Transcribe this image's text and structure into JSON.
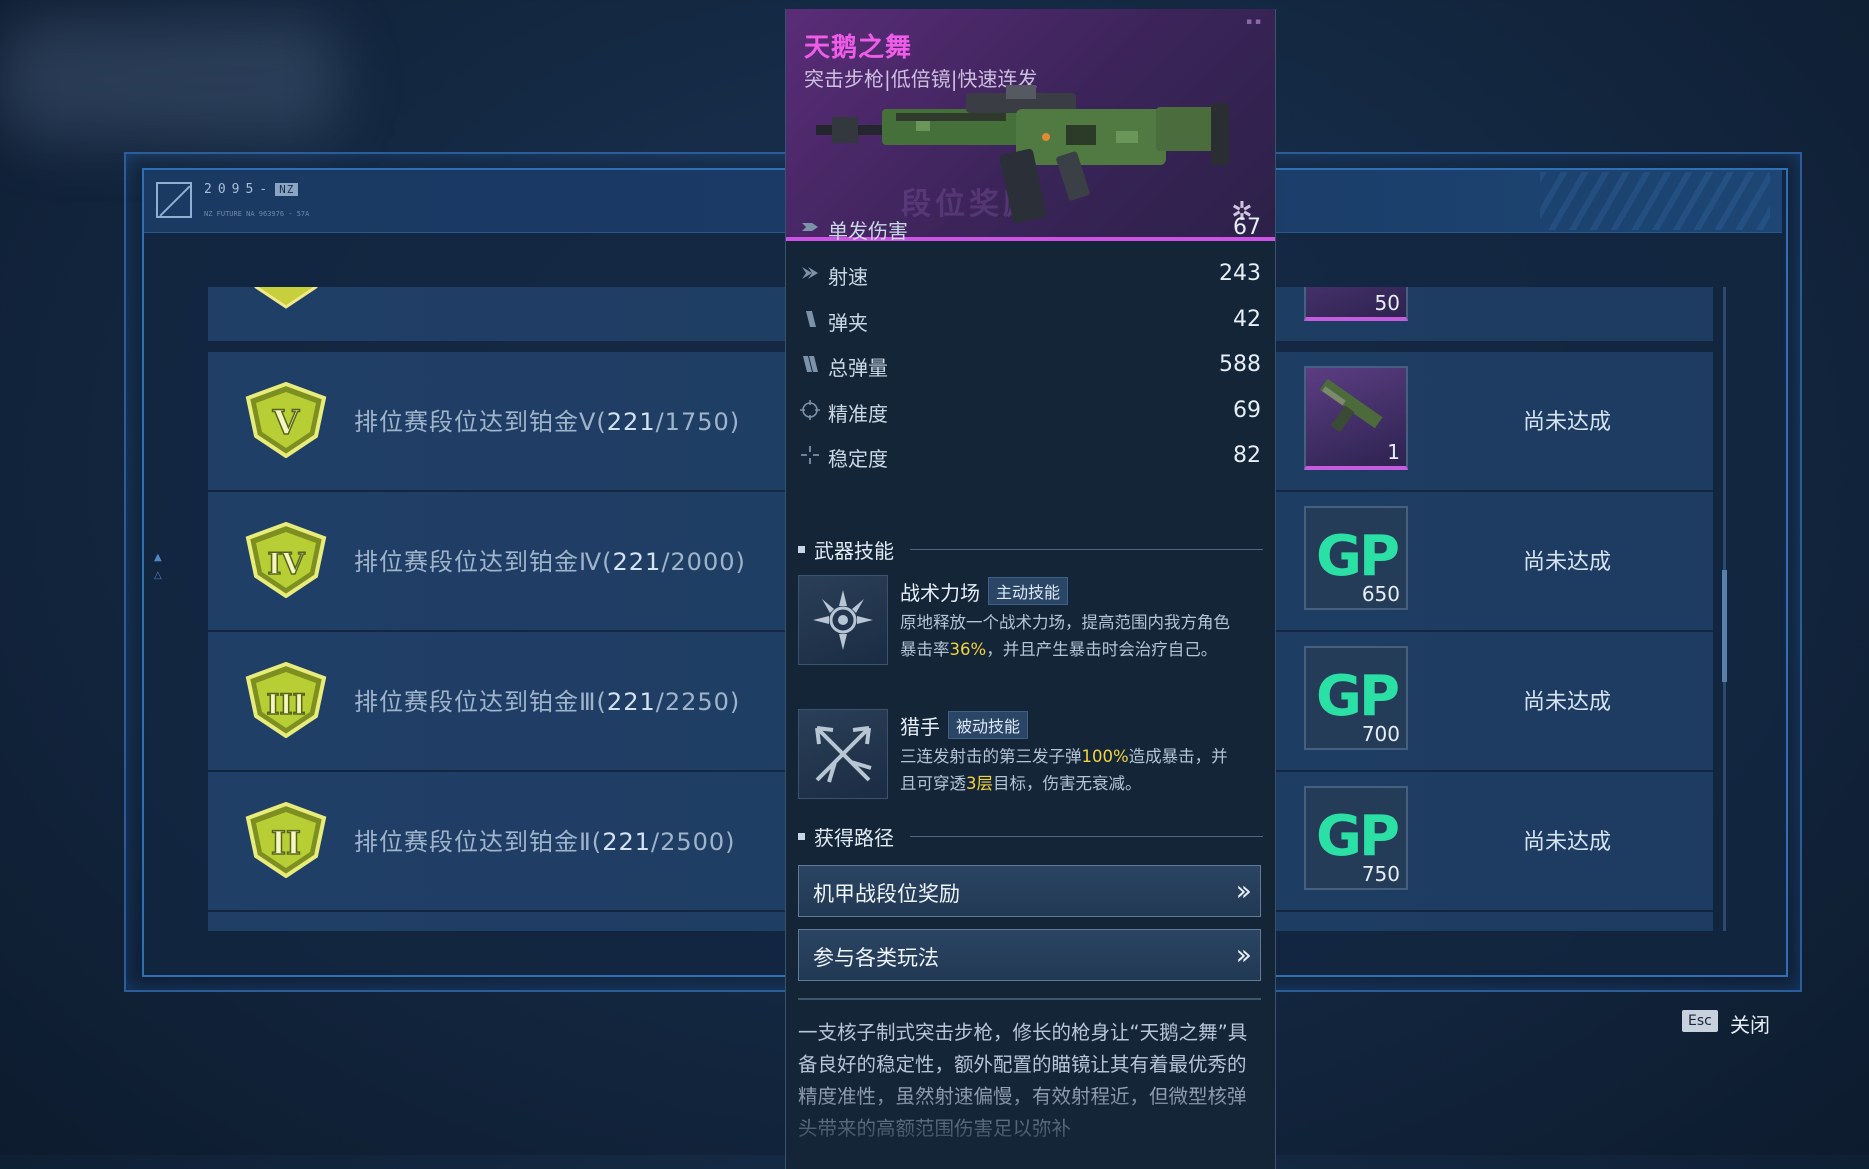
{
  "header": {
    "logo_code": "2095-",
    "logo_badge": "NZ",
    "logo_sub": "NZ FUTURE NA 963976 - 57A"
  },
  "rewards": {
    "rows": [
      {
        "prefix": "排位赛段位达到铂金Ⅴ(",
        "current": "221",
        "target": "/1750)",
        "medal": "V",
        "item": "rifle",
        "count": "1",
        "status": "尚未达成"
      },
      {
        "prefix": "排位赛段位达到铂金Ⅳ(",
        "current": "221",
        "target": "/2000)",
        "medal": "IV",
        "item": "gp",
        "count": "650",
        "status": "尚未达成"
      },
      {
        "prefix": "排位赛段位达到铂金Ⅲ(",
        "current": "221",
        "target": "/2250)",
        "medal": "III",
        "item": "gp",
        "count": "700",
        "status": "尚未达成"
      },
      {
        "prefix": "排位赛段位达到铂金Ⅱ(",
        "current": "221",
        "target": "/2500)",
        "medal": "II",
        "item": "gp",
        "count": "750",
        "status": "尚未达成"
      }
    ],
    "partial_top_count": "50"
  },
  "close": {
    "key": "Esc",
    "label": "关闭"
  },
  "weapon": {
    "name": "天鹅之舞",
    "subtitle": "突击步枪|低倍镜|快速连发",
    "watermark": "段位奖励",
    "accent": "#cf52e6",
    "stats": [
      {
        "icon": "arrow-icon",
        "label": "单发伤害",
        "value": "67"
      },
      {
        "icon": "chevron-icon",
        "label": "射速",
        "value": "243"
      },
      {
        "icon": "magazine-icon",
        "label": "弹夹",
        "value": "42"
      },
      {
        "icon": "ammo-icon",
        "label": "总弹量",
        "value": "588"
      },
      {
        "icon": "crosshair-icon",
        "label": "精准度",
        "value": "69"
      },
      {
        "icon": "stability-icon",
        "label": "稳定度",
        "value": "82"
      }
    ],
    "skills_title": "武器技能",
    "skills": [
      {
        "name": "战术力场",
        "tag": "主动技能",
        "desc_a": "原地释放一个战术力场，提高范围内我方角色暴击率",
        "desc_hl": "36%",
        "desc_b": "，并且产生暴击时会治疗自己。"
      },
      {
        "name": "猎手",
        "tag": "被动技能",
        "desc_a": "三连发射击的第三发子弹",
        "desc_hl": "100%",
        "desc_b": "造成暴击，并且可穿透",
        "desc_hl2": "3层",
        "desc_c": "目标，伤害无衰减。"
      }
    ],
    "path_title": "获得路径",
    "paths": [
      "机甲战段位奖励",
      "参与各类玩法"
    ],
    "lore": "一支核子制式突击步枪，修长的枪身让“天鹅之舞”具备良好的稳定性，额外配置的瞄镜让其有着最优秀的精度准性，虽然射速偏慢，有效射程近，但微型核弹头带来的高额范围伤害足以弥补"
  }
}
